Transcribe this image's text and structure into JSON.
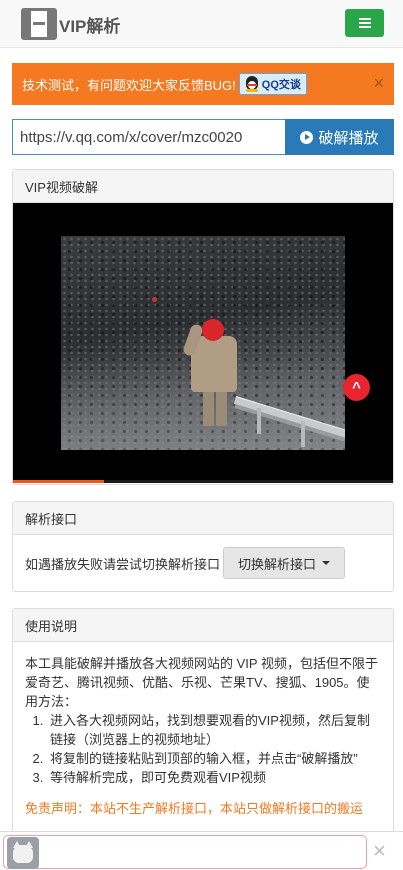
{
  "navbar": {
    "brand": "VIP解析",
    "logo_icon": "film-icon",
    "menu_icon": "hamburger-icon",
    "accent": "#2aa54a"
  },
  "alert": {
    "message": "技术测试，有问题欢迎大家反馈BUG!",
    "qq_label": "QQ交谈",
    "close": "×",
    "color": "#f47920"
  },
  "search": {
    "url_value": "https://v.qq.com/x/cover/mzc0020",
    "play_label": "破解播放",
    "play_icon": "play-circle-icon",
    "button_color": "#2a7ab8"
  },
  "video_panel": {
    "heading": "VIP视频破解",
    "badge_icon": "chevron-up-icon",
    "progress": 0.24
  },
  "interface_panel": {
    "heading": "解析接口",
    "hint": "如遇播放失败请尝试切换解析接口",
    "switch_label": "切换解析接口"
  },
  "usage_panel": {
    "heading": "使用说明",
    "intro": "本工具能破解并播放各大视频网站的 VIP 视频，包括但不限于爱奇艺、腾讯视频、优酷、乐视、芒果TV、搜狐、1905。使用方法：",
    "steps": [
      "进入各大视频网站，找到想要观看的VIP视频，然后复制链接（浏览器上的视频地址）",
      "将复制的链接粘贴到顶部的输入框，并点击“破解播放”",
      "等待解析完成，即可免费观看VIP视频"
    ],
    "disclaimer": "免责声明：本站不生产解析接口，本站只做解析接口的搬运"
  },
  "bottom_bar": {
    "avatar_icon": "cat-avatar-icon",
    "close": "×"
  }
}
